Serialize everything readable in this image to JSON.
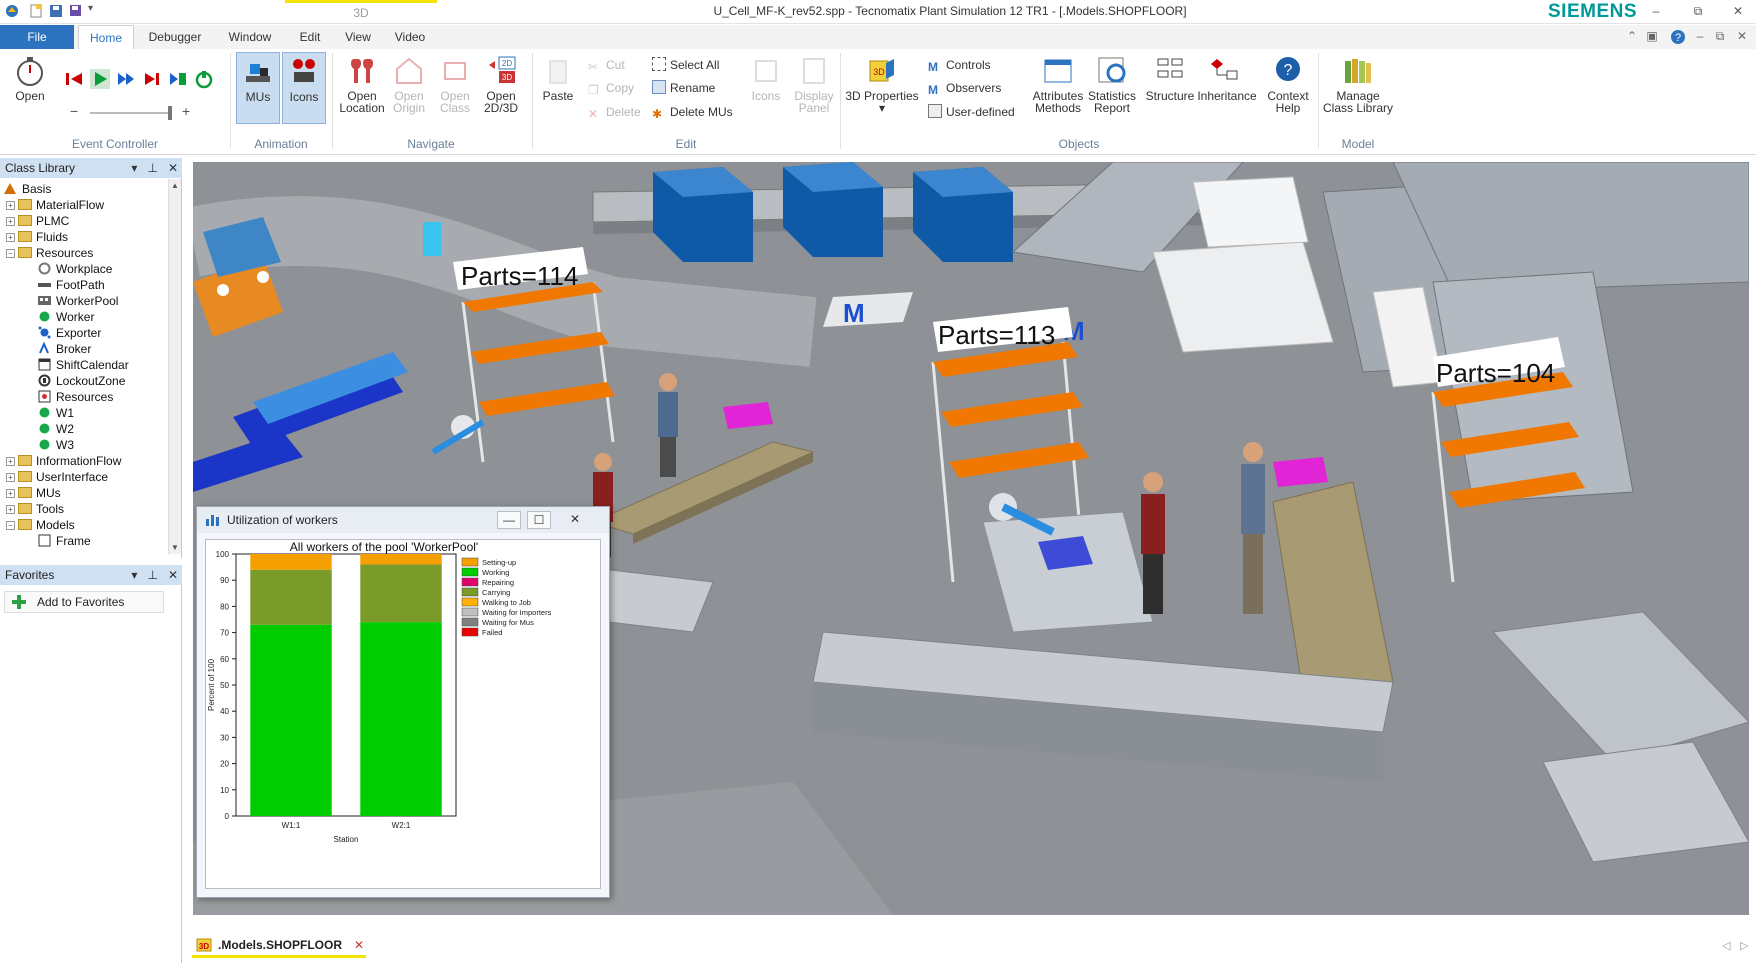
{
  "window": {
    "title": "U_Cell_MF-K_rev52.spp - Tecnomatix Plant Simulation 12 TR1 - [.Models.SHOPFLOOR]",
    "context_tab": "3D",
    "brand": "SIEMENS",
    "controls": {
      "minimize": "–",
      "restore": "⧉",
      "close": "✕"
    }
  },
  "menu_tabs": {
    "file": "File",
    "items": [
      "Home",
      "Debugger",
      "Window",
      "Edit",
      "View",
      "Video"
    ]
  },
  "ribbon": {
    "event_controller": {
      "open": "Open",
      "group": "Event Controller",
      "zoom_minus": "−",
      "zoom_plus": "+"
    },
    "animation": {
      "mus": "MUs",
      "icons": "Icons",
      "group": "Animation"
    },
    "navigate": {
      "open_location": "Open Location",
      "open_origin": "Open Origin",
      "open_class": "Open Class",
      "open_2d3d": "Open 2D/3D",
      "group": "Navigate"
    },
    "edit": {
      "paste": "Paste",
      "cut": "Cut",
      "copy": "Copy",
      "delete": "Delete",
      "select_all": "Select All",
      "rename": "Rename",
      "delete_mus": "Delete MUs",
      "icons": "Icons",
      "display_panel": "Display Panel",
      "group": "Edit"
    },
    "objects": {
      "properties_3d": "3D Properties",
      "controls": "Controls",
      "observers": "Observers",
      "user_defined": "User-defined",
      "attributes_methods": "Attributes Methods",
      "statistics_report": "Statistics Report",
      "structure": "Structure",
      "inheritance": "Inheritance",
      "group": "Objects"
    },
    "help": {
      "context_help": "Context Help"
    },
    "model": {
      "manage_class_library": "Manage Class Library",
      "group": "Model"
    }
  },
  "class_library": {
    "title": "Class Library",
    "root": "Basis",
    "folders": [
      "MaterialFlow",
      "PLMC",
      "Fluids",
      "Resources"
    ],
    "resources_children": [
      "Workplace",
      "FootPath",
      "WorkerPool",
      "Worker",
      "Exporter",
      "Broker",
      "ShiftCalendar",
      "LockoutZone",
      "Resources",
      "W1",
      "W2",
      "W3"
    ],
    "folders_after": [
      "InformationFlow",
      "UserInterface",
      "MUs",
      "Tools",
      "Models"
    ],
    "models_children": [
      "Frame"
    ]
  },
  "favorites": {
    "title": "Favorites",
    "add_button": "Add to Favorites"
  },
  "scene": {
    "labels": [
      "Parts=114",
      "Parts=113",
      "Parts=104"
    ]
  },
  "chart_window": {
    "title": "Utilization of workers",
    "buttons": {
      "minimize": "—",
      "maximize": "☐",
      "close": "✕"
    }
  },
  "chart_data": {
    "type": "bar",
    "stacked": true,
    "title": "All workers of the pool 'WorkerPool'",
    "xlabel": "Station",
    "ylabel": "Percent of 100",
    "ylim": [
      0,
      100
    ],
    "yticks": [
      0,
      10,
      20,
      30,
      40,
      50,
      60,
      70,
      80,
      90,
      100
    ],
    "categories": [
      "W1:1",
      "W2:1"
    ],
    "series": [
      {
        "name": "Working",
        "color": "#00cc00",
        "values": [
          73,
          74
        ]
      },
      {
        "name": "Carrying",
        "color": "#7a9a2a",
        "values": [
          21,
          22
        ]
      },
      {
        "name": "Setting-up",
        "color": "#f5a000",
        "values": [
          6,
          4
        ]
      }
    ],
    "legend": [
      {
        "name": "Setting-up",
        "color": "#f5a000"
      },
      {
        "name": "Working",
        "color": "#00cc00"
      },
      {
        "name": "Repairing",
        "color": "#e0006e"
      },
      {
        "name": "Carrying",
        "color": "#7a9a2a"
      },
      {
        "name": "Walking to Job",
        "color": "#ffb000"
      },
      {
        "name": "Waiting for Importers",
        "color": "#c0c0c0"
      },
      {
        "name": "Waiting for Mus",
        "color": "#808080"
      },
      {
        "name": "Failed",
        "color": "#ee0000"
      }
    ],
    "legend_position": "right"
  },
  "doc_tabs": {
    "active": ".Models.SHOPFLOOR",
    "close": "✕"
  }
}
